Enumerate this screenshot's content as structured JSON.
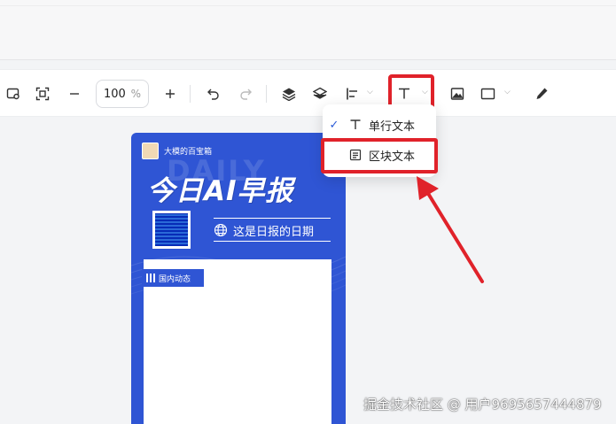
{
  "toolbar": {
    "zoom_value": "100",
    "zoom_unit": "%",
    "icons": [
      "frame-add-icon",
      "fit-screen-icon",
      "zoom-out-icon",
      "zoom-in-icon",
      "undo-icon",
      "redo-icon",
      "layer-up-icon",
      "layer-down-icon",
      "align-left-icon",
      "text-icon",
      "image-icon",
      "rectangle-icon",
      "pen-icon"
    ]
  },
  "text_menu": {
    "items": [
      {
        "label": "单行文本",
        "checked": true
      },
      {
        "label": "区块文本",
        "checked": false
      }
    ]
  },
  "poster": {
    "author": "大模的百宝箱",
    "title": "今日AI早报",
    "date_text": "这是日报的日期",
    "section_label": "国内动态"
  },
  "watermark": "掘金技术社区 @ 用户9695657444879",
  "colors": {
    "highlight": "#e0222a",
    "poster_bg": "#2f55d4",
    "check": "#2b5bd7"
  }
}
